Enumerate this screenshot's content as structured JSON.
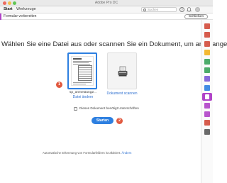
{
  "window": {
    "title": "Adobe Pro DC"
  },
  "nav": {
    "tabs": [
      {
        "label": "Start"
      },
      {
        "label": "Werkzeuge"
      }
    ],
    "search_placeholder": "Suchen",
    "help_icon_glyph": "?",
    "bell_icon_glyph": "🔔"
  },
  "toolbar": {
    "tool_name": "Formular vorbereiten",
    "close_label": "Schließen",
    "accent_color": "#b043c8"
  },
  "main": {
    "heading": "Wählen Sie eine Datei aus oder scannen Sie ein Dokument, um anzufangen",
    "file": {
      "name": "sp_anmeldung2...",
      "change_label": "Datei ändern"
    },
    "scanner": {
      "label": "Dokument scannen"
    },
    "signature_checkbox_label": "Dieses Dokument benötigt Unterschriften",
    "start_label": "Starten",
    "badges": [
      "1",
      "2"
    ],
    "footer": {
      "text": "Automatische Erkennung von Formularfeldern ist aktiviert.",
      "link": "Ändern"
    }
  },
  "rail": {
    "icons": [
      {
        "name": "export-pdf-icon",
        "color": "#d24a3a"
      },
      {
        "name": "edit-pdf-icon",
        "color": "#d24a3a"
      },
      {
        "name": "create-pdf-icon",
        "color": "#d24a3a"
      },
      {
        "name": "comment-icon",
        "color": "#f2b01c"
      },
      {
        "name": "combine-files-icon",
        "color": "#3aa35a"
      },
      {
        "name": "organize-pages-icon",
        "color": "#3aa35a"
      },
      {
        "name": "scan-ocr-icon",
        "color": "#7b5ad6"
      },
      {
        "name": "protect-icon",
        "color": "#2d7fe0"
      },
      {
        "name": "prepare-form-icon",
        "color": "#b043c8",
        "active": true
      },
      {
        "name": "fill-sign-icon",
        "color": "#b043c8"
      },
      {
        "name": "send-for-signature-icon",
        "color": "#b043c8"
      },
      {
        "name": "rich-media-icon",
        "color": "#d24a3a"
      },
      {
        "name": "more-tools-icon",
        "color": "#5a5a5a"
      }
    ]
  }
}
